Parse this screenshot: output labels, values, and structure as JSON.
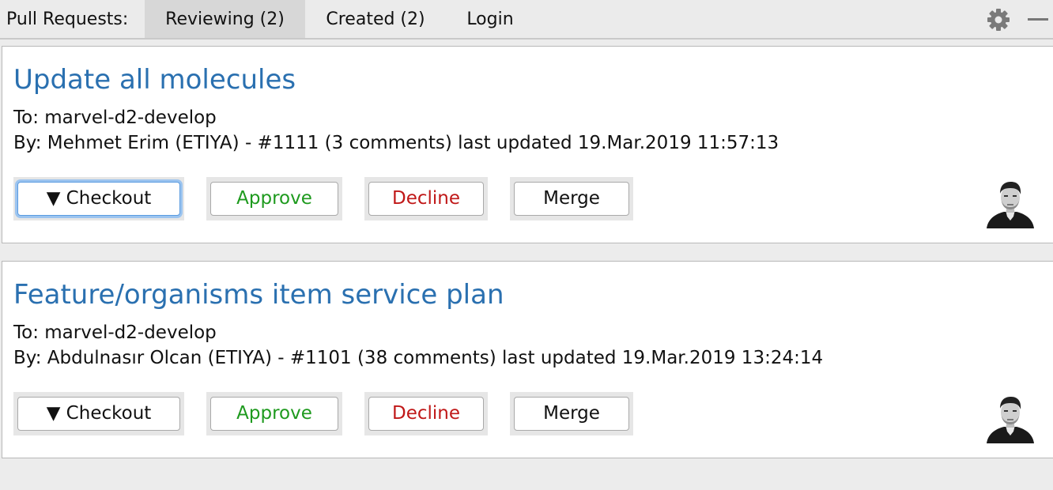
{
  "header": {
    "label": "Pull Requests:",
    "tabs": [
      {
        "label": "Reviewing (2)",
        "active": true
      },
      {
        "label": "Created (2)",
        "active": false
      },
      {
        "label": "Login",
        "active": false
      }
    ],
    "icons": {
      "settings": "gear-icon",
      "minimize": "minimize-icon"
    }
  },
  "pull_requests": [
    {
      "title": "Update all molecules",
      "to": "To: marvel-d2-develop",
      "by": "By: Mehmet Erim (ETIYA) - #1111 (3 comments) last updated 19.Mar.2019 11:57:13",
      "buttons": {
        "checkout": "▼ Checkout",
        "approve": "Approve",
        "decline": "Decline",
        "merge": "Merge"
      }
    },
    {
      "title": "Feature/organisms item service plan",
      "to": "To: marvel-d2-develop",
      "by": "By: Abdulnasır Olcan (ETIYA) - #1101 (38 comments) last updated 19.Mar.2019 13:24:14",
      "buttons": {
        "checkout": "▼ Checkout",
        "approve": "Approve",
        "decline": "Decline",
        "merge": "Merge"
      }
    }
  ],
  "colors": {
    "title": "#2a70b0",
    "approve": "#1e9a1e",
    "decline": "#c01818",
    "focus_ring": "#9cc4ef"
  }
}
